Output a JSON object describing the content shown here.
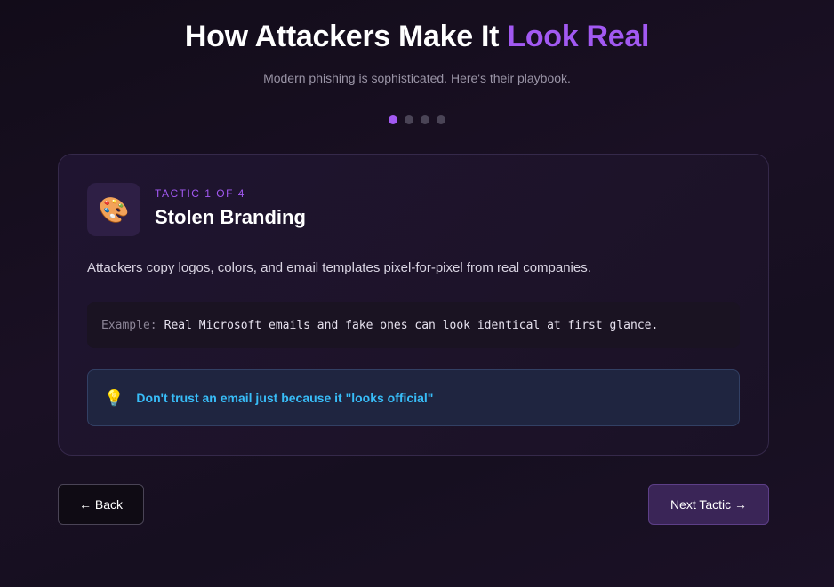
{
  "header": {
    "title_main": "How Attackers Make It ",
    "title_accent": "Look Real",
    "subtitle": "Modern phishing is sophisticated. Here's their playbook."
  },
  "progress": {
    "total": 4,
    "current": 1
  },
  "tactic": {
    "icon": "palette-icon",
    "icon_glyph": "🎨",
    "counter": "TACTIC 1 OF 4",
    "title": "Stolen Branding",
    "description": "Attackers copy logos, colors, and email templates pixel-for-pixel from real companies.",
    "example_label": "Example:",
    "example_text": "Real Microsoft emails and fake ones can look identical at first glance.",
    "tip_icon": "lightbulb-icon",
    "tip_glyph": "💡",
    "tip_text": "Don't trust an email just because it \"looks official\""
  },
  "nav": {
    "back_label": "← Back",
    "next_label": "Next Tactic →"
  },
  "colors": {
    "accent": "#a259f2",
    "tip": "#38bdf8",
    "background": "#150f1d"
  }
}
